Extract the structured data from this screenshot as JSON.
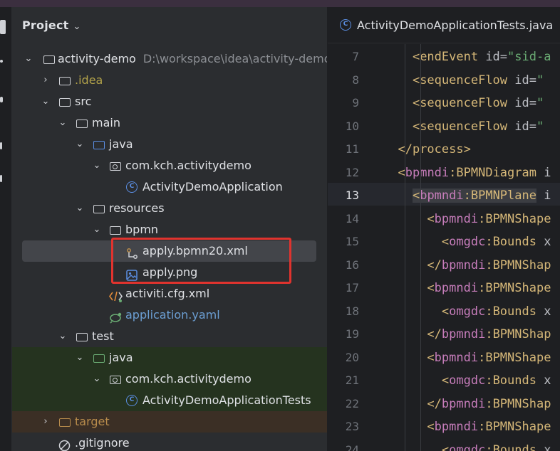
{
  "project_panel": {
    "title": "Project",
    "tree": [
      {
        "label": "activity-demo",
        "extra": "D:\\workspace\\idea\\activity-demo",
        "icon": "module-folder-icon",
        "arrow": "⌄",
        "level": 0
      },
      {
        "label": ".idea",
        "icon": "folder-icon",
        "arrow": "›",
        "level": 1
      },
      {
        "label": "src",
        "icon": "folder-icon",
        "arrow": "⌄",
        "level": 1
      },
      {
        "label": "main",
        "icon": "folder-icon",
        "arrow": "⌄",
        "level": 2
      },
      {
        "label": "java",
        "icon": "source-folder-icon",
        "arrow": "⌄",
        "level": 3
      },
      {
        "label": "com.kch.activitydemo",
        "icon": "package-icon",
        "arrow": "⌄",
        "level": 4
      },
      {
        "label": "ActivityDemoApplication",
        "icon": "spring-class-icon",
        "arrow": "",
        "level": 5
      },
      {
        "label": "resources",
        "icon": "resources-folder-icon",
        "arrow": "⌄",
        "level": 3
      },
      {
        "label": "bpmn",
        "icon": "folder-icon",
        "arrow": "⌄",
        "level": 4
      },
      {
        "label": "apply.bpmn20.xml",
        "icon": "bpmn-file-icon",
        "arrow": "",
        "level": 5
      },
      {
        "label": "apply.png",
        "icon": "image-file-icon",
        "arrow": "",
        "level": 5
      },
      {
        "label": "activiti.cfg.xml",
        "icon": "xml-file-icon",
        "arrow": "",
        "level": 4
      },
      {
        "label": "application.yaml",
        "icon": "yaml-file-icon",
        "arrow": "",
        "level": 4
      },
      {
        "label": "test",
        "icon": "folder-icon",
        "arrow": "⌄",
        "level": 2
      },
      {
        "label": "java",
        "icon": "test-folder-icon",
        "arrow": "⌄",
        "level": 3
      },
      {
        "label": "com.kch.activitydemo",
        "icon": "package-icon",
        "arrow": "⌄",
        "level": 4
      },
      {
        "label": "ActivityDemoApplicationTests",
        "icon": "class-icon",
        "arrow": "",
        "level": 5
      },
      {
        "label": "target",
        "icon": "excluded-folder-icon",
        "arrow": "›",
        "level": 1
      },
      {
        "label": ".gitignore",
        "icon": "ignore-file-icon",
        "arrow": "",
        "level": 1
      }
    ]
  },
  "editor": {
    "tab_title": "ActivityDemoApplicationTests.java",
    "line_numbers": [
      "7",
      "8",
      "9",
      "10",
      "11",
      "12",
      "13",
      "14",
      "15",
      "16",
      "17",
      "18",
      "19",
      "20",
      "21",
      "22",
      "23",
      "24"
    ],
    "current_line": "13",
    "lines": [
      {
        "indent": "    ",
        "ns": "",
        "tag": "<endEvent",
        "rest": " id=\"sid-a"
      },
      {
        "indent": "    ",
        "ns": "",
        "tag": "<sequenceFlow",
        "rest": " id=\""
      },
      {
        "indent": "    ",
        "ns": "",
        "tag": "<sequenceFlow",
        "rest": " id=\""
      },
      {
        "indent": "    ",
        "ns": "",
        "tag": "<sequenceFlow",
        "rest": " id=\""
      },
      {
        "indent": "  ",
        "ns": "",
        "tag": "</process>",
        "rest": ""
      },
      {
        "indent": "  ",
        "ns": "bpmndi",
        "tag": "<bpmndi:BPMNDiagram",
        "rest": " i"
      },
      {
        "indent": "    ",
        "ns": "bpmndi",
        "tag": "<bpmndi:BPMNPlane",
        "rest": " i"
      },
      {
        "indent": "      ",
        "ns": "bpmndi",
        "tag": "<bpmndi:BPMNShape",
        "rest": ""
      },
      {
        "indent": "        ",
        "ns": "omgdc",
        "tag": "<omgdc:Bounds",
        "rest": " x"
      },
      {
        "indent": "      ",
        "ns": "bpmndi",
        "tag": "</bpmndi:BPMNShap",
        "rest": ""
      },
      {
        "indent": "      ",
        "ns": "bpmndi",
        "tag": "<bpmndi:BPMNShape",
        "rest": ""
      },
      {
        "indent": "        ",
        "ns": "omgdc",
        "tag": "<omgdc:Bounds",
        "rest": " x"
      },
      {
        "indent": "      ",
        "ns": "bpmndi",
        "tag": "</bpmndi:BPMNShap",
        "rest": ""
      },
      {
        "indent": "      ",
        "ns": "bpmndi",
        "tag": "<bpmndi:BPMNShape",
        "rest": ""
      },
      {
        "indent": "        ",
        "ns": "omgdc",
        "tag": "<omgdc:Bounds",
        "rest": " x"
      },
      {
        "indent": "      ",
        "ns": "bpmndi",
        "tag": "</bpmndi:BPMNShap",
        "rest": ""
      },
      {
        "indent": "      ",
        "ns": "bpmndi",
        "tag": "<bpmndi:BPMNShape",
        "rest": ""
      },
      {
        "indent": "        ",
        "ns": "omgdc",
        "tag": "<omgdc:Bounds",
        "rest": " x"
      }
    ]
  },
  "colors": {
    "highlight_box": "#e0332e",
    "selection": "#43454a",
    "test_background": "#25331f",
    "excluded_background": "#3b2f25",
    "xml_tag": "#d5b778"
  }
}
